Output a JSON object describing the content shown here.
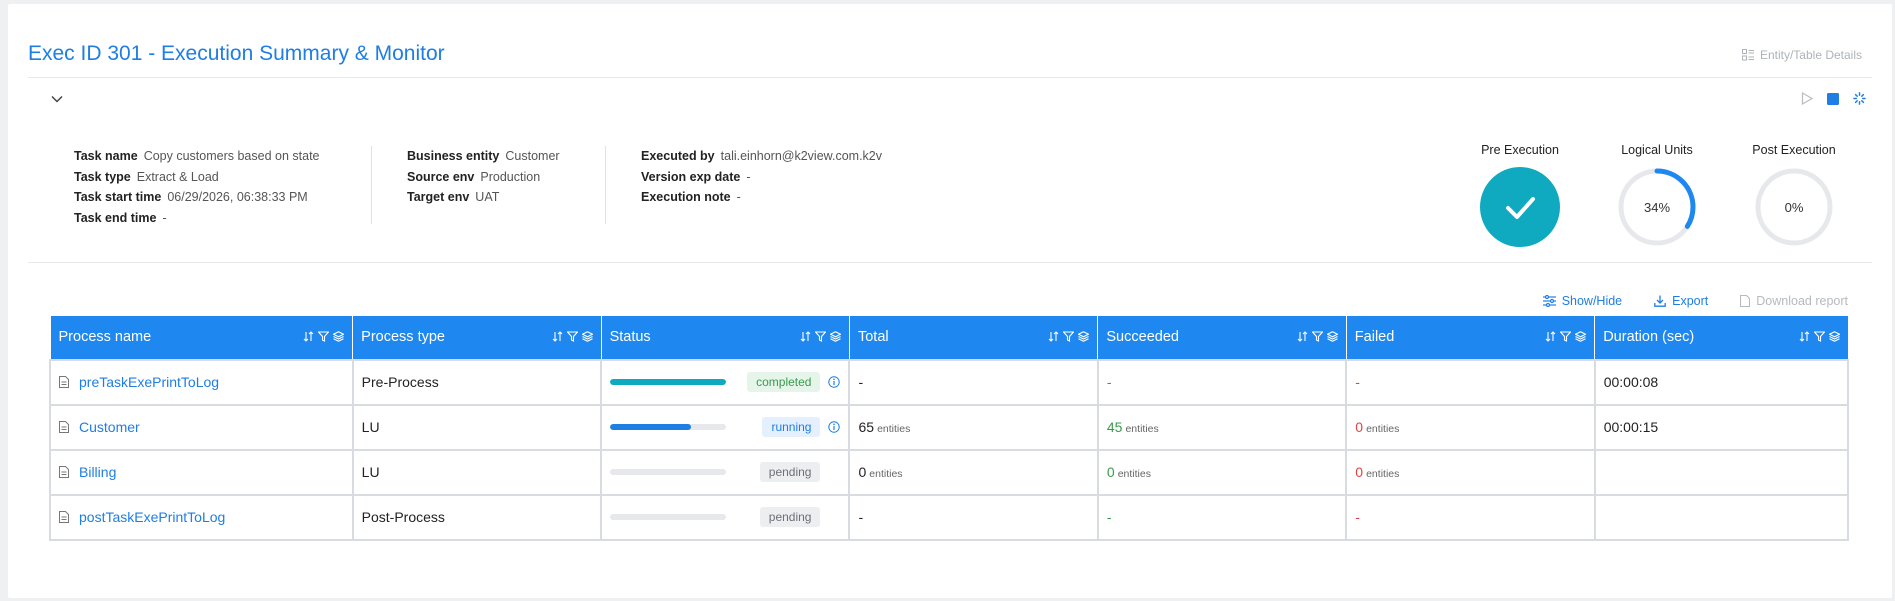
{
  "header": {
    "title": "Exec ID 301 - Execution Summary & Monitor",
    "entity_link": "Entity/Table Details"
  },
  "info": {
    "col1": [
      {
        "label": "Task name",
        "value": "Copy customers based on state"
      },
      {
        "label": "Task type",
        "value": "Extract & Load"
      },
      {
        "label": "Task start time",
        "value": "06/29/2026, 06:38:33 PM"
      },
      {
        "label": "Task end time",
        "value": "-"
      }
    ],
    "col2": [
      {
        "label": "Business entity",
        "value": "Customer"
      },
      {
        "label": "Source env",
        "value": "Production"
      },
      {
        "label": "Target env",
        "value": "UAT"
      }
    ],
    "col3": [
      {
        "label": "Executed by",
        "value": "tali.einhorn@k2view.com.k2v"
      },
      {
        "label": "Version exp date",
        "value": "-"
      },
      {
        "label": "Execution note",
        "value": "-"
      }
    ]
  },
  "progress": [
    {
      "label": "Pre Execution",
      "percent": 100,
      "done": true
    },
    {
      "label": "Logical Units",
      "percent": 34,
      "text": "34%"
    },
    {
      "label": "Post Execution",
      "percent": 0,
      "text": "0%"
    }
  ],
  "toolbar": {
    "show_hide": "Show/Hide",
    "export": "Export",
    "download": "Download report"
  },
  "colors": {
    "accent": "#1e88f0",
    "teal": "#10aac0",
    "green": "#3a9a4e",
    "red": "#e34242"
  },
  "table": {
    "columns": [
      "Process name",
      "Process type",
      "Status",
      "Total",
      "Succeeded",
      "Failed",
      "Duration (sec)"
    ],
    "rows": [
      {
        "name": "preTaskExePrintToLog",
        "type": "Pre-Process",
        "progress": 100,
        "bar_color": "#10aac0",
        "status": "completed",
        "info": true,
        "total": "-",
        "total_unit": "",
        "succ": "-",
        "succ_unit": "",
        "fail": "-",
        "fail_unit": "",
        "duration": "00:00:08"
      },
      {
        "name": "Customer",
        "type": "LU",
        "progress": 70,
        "bar_color": "#1e7ee4",
        "status": "running",
        "info": true,
        "total": "65",
        "total_unit": "entities",
        "succ": "45",
        "succ_unit": "entities",
        "fail": "0",
        "fail_unit": "entities",
        "duration": "00:00:15"
      },
      {
        "name": "Billing",
        "type": "LU",
        "progress": 0,
        "bar_color": "#1e7ee4",
        "status": "pending",
        "info": false,
        "total": "0",
        "total_unit": "entities",
        "succ": "0",
        "succ_unit": "entities",
        "fail": "0",
        "fail_unit": "entities",
        "duration": ""
      },
      {
        "name": "postTaskExePrintToLog",
        "type": "Post-Process",
        "progress": 0,
        "bar_color": "#1e7ee4",
        "status": "pending",
        "info": false,
        "total": "-",
        "total_unit": "",
        "succ": "-",
        "succ_unit": "",
        "fail": "-",
        "fail_unit": "",
        "duration": ""
      }
    ]
  }
}
